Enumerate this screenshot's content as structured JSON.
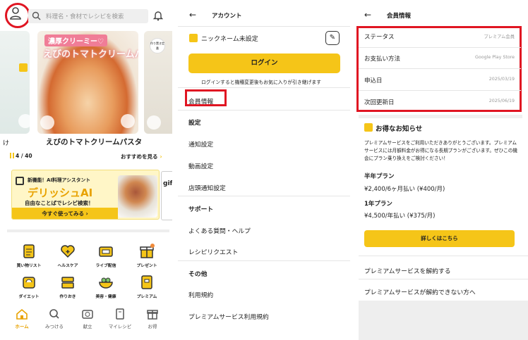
{
  "panel_home": {
    "search": {
      "placeholder": "料理名・食材でレシピを検索"
    },
    "carousel": {
      "banner_line1": "濃厚クリーミー♡",
      "banner_line2": "えびのトマトクリームパスタ",
      "side_left_text": "け",
      "side_right_tag": "作り置き定番",
      "recipe_title": "えびのトマトクリームパスタ",
      "page_indicator": "4 / 40",
      "see_more": "おすすめを見る"
    },
    "ai_banner": {
      "subtitle": "新機能！AI料理アシスタント",
      "big_title": "デリッシュAI",
      "tagline": "自由なことばでレシピ検索！",
      "cta": "今すぐ使ってみる",
      "side_card_text": "gif"
    },
    "grid": [
      {
        "label": "買い物リスト",
        "icon": "shopping-list-icon"
      },
      {
        "label": "ヘルスケア",
        "icon": "healthcare-icon"
      },
      {
        "label": "ライブ配信",
        "icon": "live-stream-icon"
      },
      {
        "label": "プレゼント",
        "icon": "present-icon"
      },
      {
        "label": "ダイエット",
        "icon": "diet-icon"
      },
      {
        "label": "作りおき",
        "icon": "meal-prep-icon"
      },
      {
        "label": "美容・健康",
        "icon": "beauty-health-icon"
      },
      {
        "label": "プレミアム",
        "icon": "premium-icon"
      }
    ],
    "bottom_nav": [
      {
        "label": "ホーム",
        "icon": "home-icon",
        "active": true
      },
      {
        "label": "みつける",
        "icon": "search-icon",
        "active": false
      },
      {
        "label": "献立",
        "icon": "menu-plan-icon",
        "active": false
      },
      {
        "label": "マイレシピ",
        "icon": "my-recipe-icon",
        "active": false
      },
      {
        "label": "お得",
        "icon": "deals-icon",
        "active": false
      }
    ]
  },
  "panel_account": {
    "header_title": "アカウント",
    "nickname": "ニックネーム未設定",
    "login_button": "ログイン",
    "login_note": "ログインすると機種変更後もお気に入りが引き継げます",
    "member_info": "会員情報",
    "menu": [
      {
        "label": "設定",
        "section": true
      },
      {
        "label": "通知設定",
        "section": false
      },
      {
        "label": "動画設定",
        "section": false
      },
      {
        "label": "店頭通知設定",
        "section": false
      },
      {
        "label": "サポート",
        "section": true
      },
      {
        "label": "よくある質問・ヘルプ",
        "section": false
      },
      {
        "label": "レシピリクエスト",
        "section": false
      },
      {
        "label": "その他",
        "section": true
      },
      {
        "label": "利用規約",
        "section": false
      },
      {
        "label": "プレミアムサービス利用規約",
        "section": false
      }
    ]
  },
  "panel_member": {
    "header_title": "会員情報",
    "info_rows": [
      {
        "label": "ステータス",
        "value": "プレミアム会員"
      },
      {
        "label": "お支払い方法",
        "value": "Google Play Store"
      },
      {
        "label": "申込日",
        "value": "2025/03/19"
      },
      {
        "label": "次回更新日",
        "value": "2025/06/19"
      }
    ],
    "notice_title": "お得なお知らせ",
    "notice_body": "プレミアムサービスをご利用いただきありがとうございます。プレミアムサービスには月額料金がお得になる長期プランがございます。ぜひこの機会にプラン乗り換えをご検討ください！",
    "plans": [
      {
        "name": "半年プラン",
        "price": "¥2,400/6ヶ月払い (¥400/月)"
      },
      {
        "name": "1年プラン",
        "price": "¥4,500/年払い (¥375/月)"
      }
    ],
    "detail_button": "詳しくはこちら",
    "cancel_link": "プレミアムサービスを解約する",
    "cannot_cancel_link": "プレミアムサービスが解約できない方へ"
  },
  "colors": {
    "accent_yellow": "#f5c518",
    "highlight_red": "#e01522",
    "text_dark": "#222222",
    "text_muted": "#999999"
  }
}
